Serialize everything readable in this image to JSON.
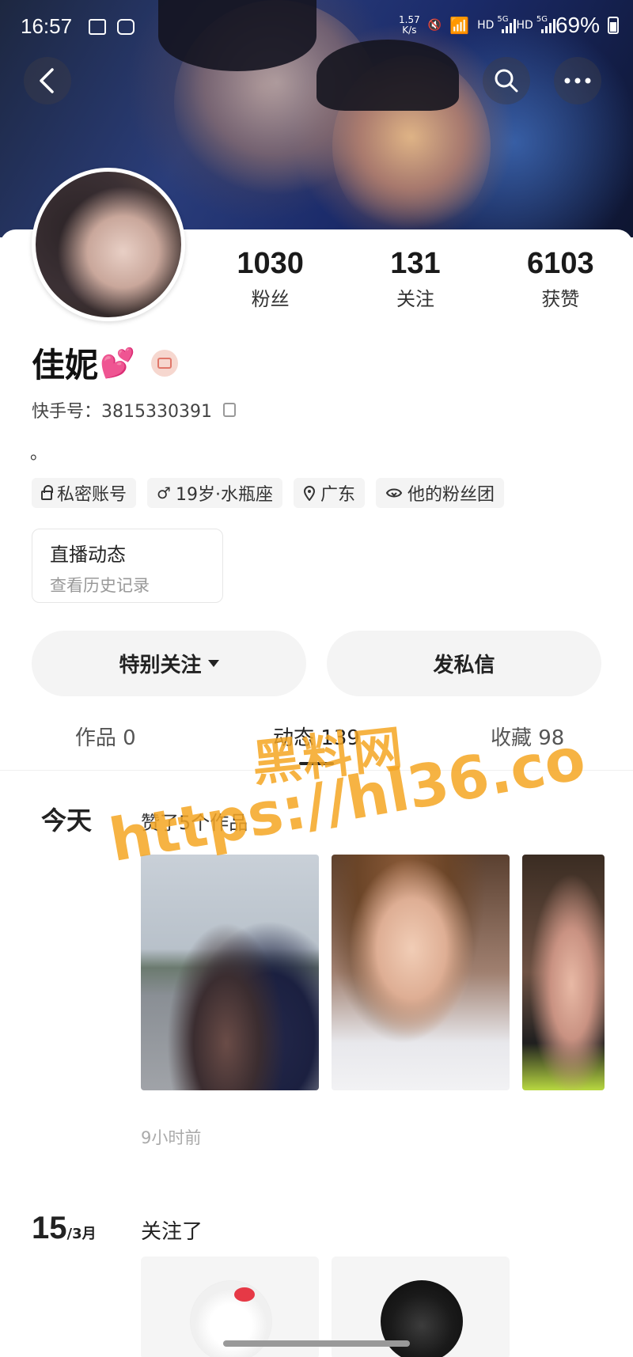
{
  "status_bar": {
    "time": "16:57",
    "net_speed_value": "1.57",
    "net_speed_unit": "K/s",
    "hd1": "HD",
    "g1": "5G",
    "hd2": "HD",
    "g2": "5G",
    "battery": "69%"
  },
  "profile": {
    "name": "佳妮",
    "name_emoji": "💕",
    "kuaishou_id": "快手号：3815330391",
    "bio": "。",
    "tags": [
      "私密账号",
      "19岁·水瓶座",
      "广东",
      "他的粉丝团"
    ]
  },
  "stats": [
    {
      "value": "1030",
      "label": "粉丝"
    },
    {
      "value": "131",
      "label": "关注"
    },
    {
      "value": "6103",
      "label": "获赞"
    }
  ],
  "live_card": {
    "title": "直播动态",
    "subtitle": "查看历史记录"
  },
  "actions": {
    "special_follow": "特别关注",
    "message": "发私信"
  },
  "tabs": [
    "作品 0",
    "动态 139",
    "收藏 98"
  ],
  "active_tab": 1,
  "feed": {
    "today": {
      "day_label": "今天",
      "title": "赞了5个作品",
      "time": "9小时前"
    },
    "march15": {
      "day": "15",
      "month": "/3月",
      "title": "关注了"
    }
  },
  "watermark": {
    "line1": "黑料网",
    "line2": "https://hl36.co"
  },
  "colors": {
    "accent_watermark": "#f5a623",
    "heart": "#ff4fb8"
  }
}
